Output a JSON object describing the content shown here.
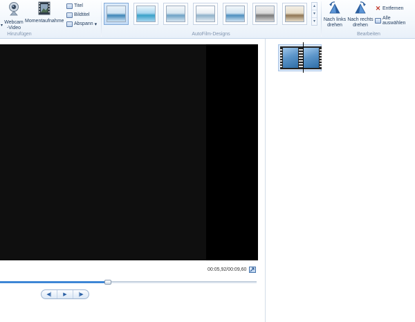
{
  "ribbon": {
    "add_group": {
      "label": "Hinzufügen",
      "webcam_label_1": "Webcam",
      "webcam_label_2": "-Video",
      "snapshot_label": "Momentaufnahme",
      "title_label": "Titel",
      "caption_label": "Bildtitel",
      "credits_label": "Abspann",
      "credits_arrow": "▾"
    },
    "themes_group": {
      "label": "AutoFilm-Designs",
      "themes": [
        {
          "name": "theme-1",
          "colors": [
            "#cfe3f2",
            "#3f86b8",
            "#e8f1f8"
          ],
          "selected": true
        },
        {
          "name": "theme-2",
          "colors": [
            "#a8d6ef",
            "#3aa1c9",
            "#e9f5fb"
          ],
          "selected": false
        },
        {
          "name": "theme-3",
          "colors": [
            "#d7e6f0",
            "#6fa3c6",
            "#f4f7fa"
          ],
          "selected": false
        },
        {
          "name": "theme-4",
          "colors": [
            "#e8eef3",
            "#8fb2cb",
            "#ffffff"
          ],
          "selected": false
        },
        {
          "name": "theme-5",
          "colors": [
            "#cfe2f1",
            "#4e8fbf",
            "#f3f7fb"
          ],
          "selected": false
        },
        {
          "name": "theme-6",
          "colors": [
            "#d9d9d9",
            "#7a7a7a",
            "#f0f0f0"
          ],
          "selected": false
        },
        {
          "name": "theme-7",
          "colors": [
            "#e6dcc8",
            "#8f7654",
            "#f4efe6"
          ],
          "selected": false
        }
      ],
      "scroll_up": "▴",
      "scroll_down": "▾",
      "more": "▾"
    },
    "edit_group": {
      "label": "Bearbeiten",
      "rotate_left_1": "Nach links",
      "rotate_left_2": "drehen",
      "rotate_right_1": "Nach rechts",
      "rotate_right_2": "drehen",
      "remove_label": "Entfernen",
      "select_all_label": "Alle auswählen"
    }
  },
  "player": {
    "time": "00:05,92/00:09,60",
    "progress": 0.42,
    "prev_frame": "◀|",
    "play": "▶",
    "next_frame": "|▶"
  },
  "colors": {
    "accent": "#3d86d5",
    "preview_bg": "#000000",
    "remove_x": "#c0392b"
  }
}
